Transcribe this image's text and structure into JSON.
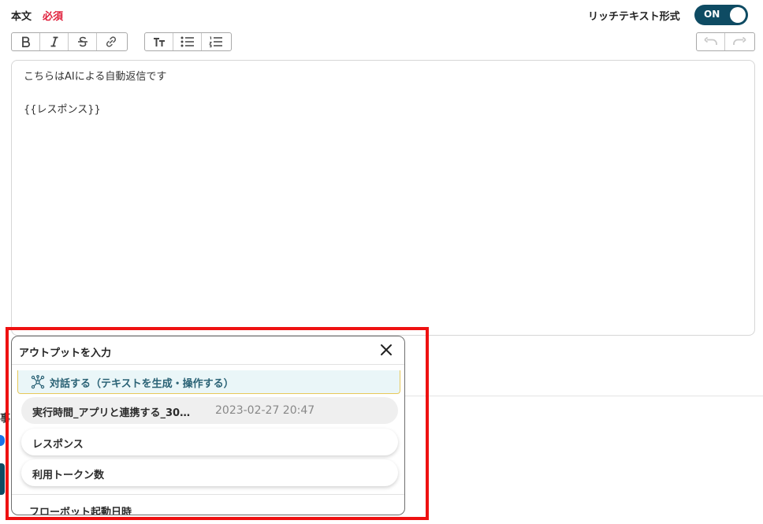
{
  "field": {
    "label": "本文",
    "required": "必須"
  },
  "rich_text": {
    "label": "リッチテキスト形式",
    "toggle": "ON"
  },
  "toolbar": {
    "format": [
      "bold-icon",
      "italic-icon",
      "strikethrough-icon",
      "link-icon"
    ],
    "text": [
      "text-size-icon",
      "bullet-list-icon",
      "numbered-list-icon"
    ],
    "history": [
      "undo-icon",
      "redo-icon"
    ]
  },
  "editor": {
    "lines": [
      "こちらはAIによる自動返信です",
      "",
      "{{レスポンス}}"
    ]
  },
  "peek": {
    "text": "事"
  },
  "popup": {
    "title": "アウトプットを入力",
    "operation": "対話する（テキストを生成・操作する）",
    "rows": [
      {
        "name": "実行時間_アプリと連携する_30…",
        "value": "2023-02-27 20:47"
      },
      {
        "name": "レスポンス",
        "value": ""
      },
      {
        "name": "利用トークン数",
        "value": ""
      }
    ],
    "next_operation": "フローボット起動日時"
  },
  "colors": {
    "toggle_bg": "#0e4b63",
    "required": "#e0203c",
    "highlight": "#ee1111",
    "op_header_bg": "#eaf6f8",
    "op_header_border": "#e7c95a"
  }
}
